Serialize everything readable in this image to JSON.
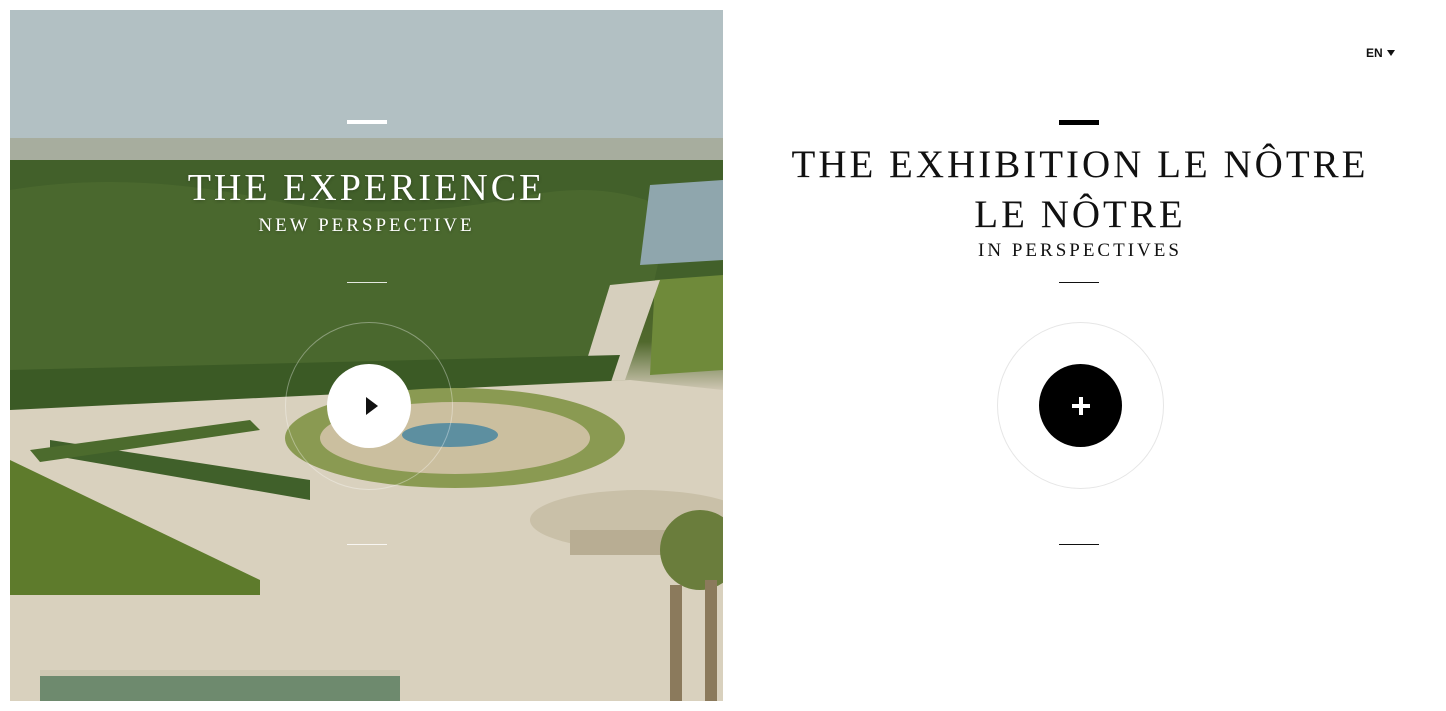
{
  "language": {
    "current": "EN",
    "icon": "caret-down-icon"
  },
  "experience": {
    "title": "THE EXPERIENCE",
    "subtitle": "NEW PERSPECTIVE",
    "play_icon": "play-icon"
  },
  "exhibition": {
    "title_line1": "THE EXHIBITION LE NÔTRE",
    "title_line2": "LE NÔTRE",
    "subtitle": "IN PERSPECTIVES",
    "plus_icon": "plus-icon"
  },
  "colors": {
    "accent": "#000000",
    "background": "#ffffff",
    "overlay_text": "#ffffff"
  }
}
